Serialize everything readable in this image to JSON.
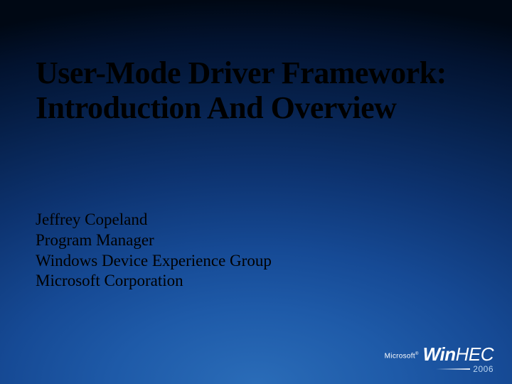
{
  "title": "User-Mode Driver Framework:  Introduction And Overview",
  "speaker": {
    "name": "Jeffrey Copeland",
    "role": "Program Manager",
    "group": "Windows Device Experience Group",
    "company": "Microsoft Corporation"
  },
  "branding": {
    "company": "Microsoft",
    "event_prefix": "Win",
    "event_suffix": "HEC",
    "year": "2006"
  }
}
